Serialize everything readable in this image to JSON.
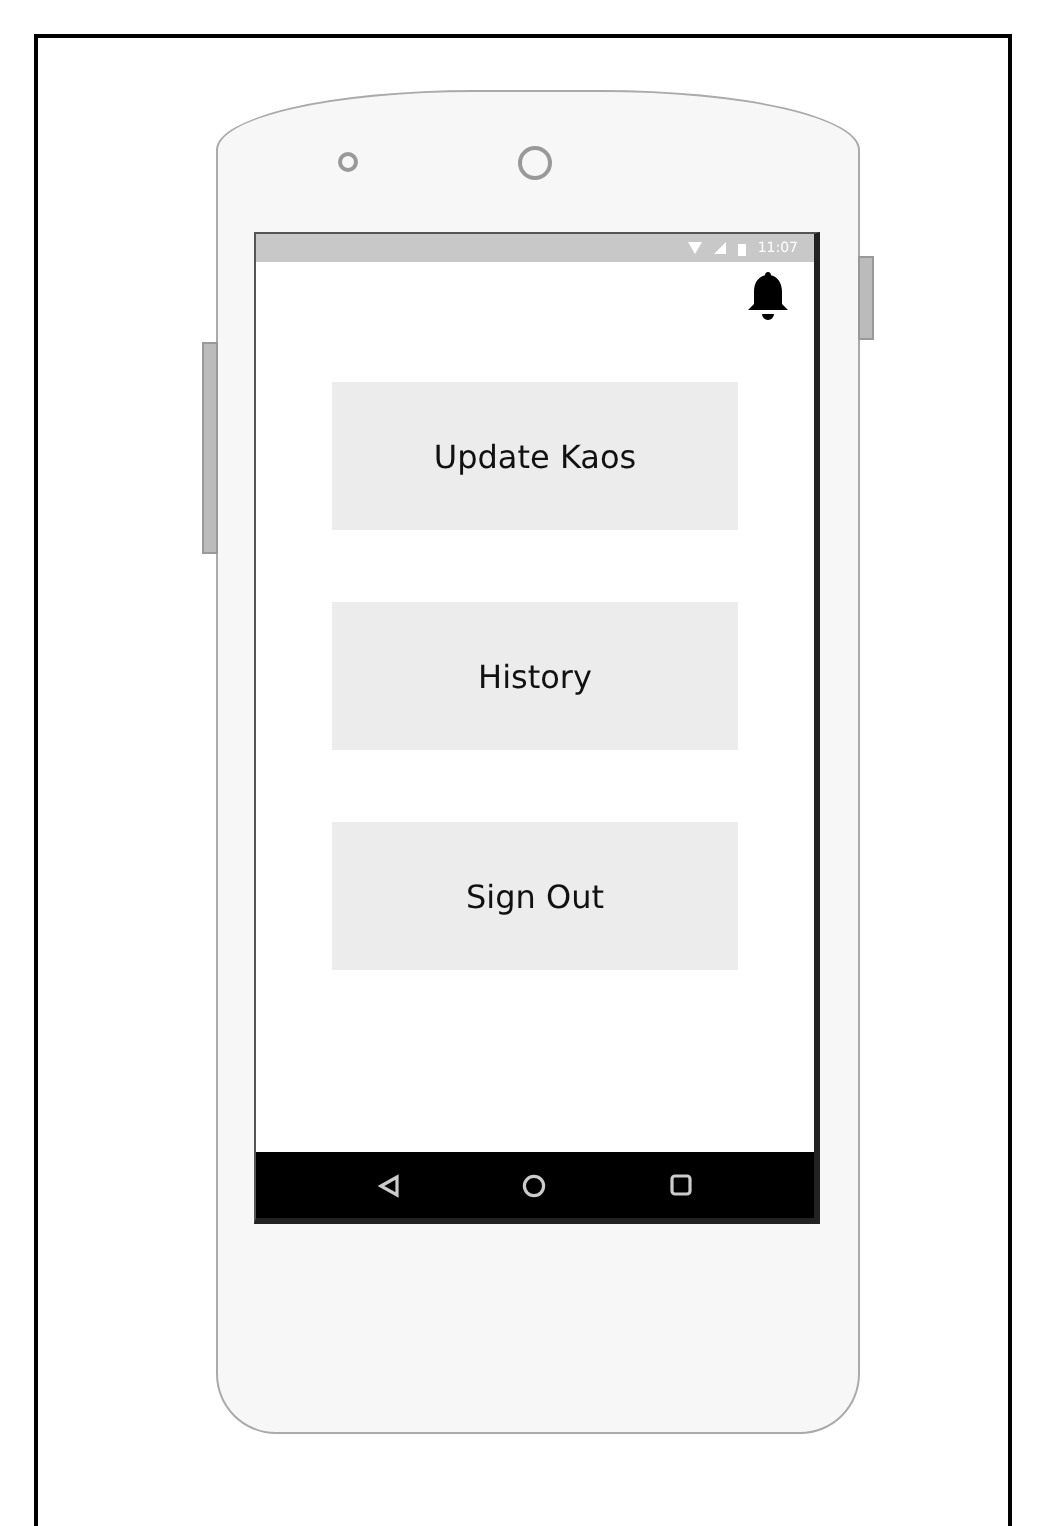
{
  "status_bar": {
    "time": "11:07"
  },
  "buttons": [
    {
      "label": "Update Kaos"
    },
    {
      "label": "History"
    },
    {
      "label": "Sign Out"
    }
  ]
}
